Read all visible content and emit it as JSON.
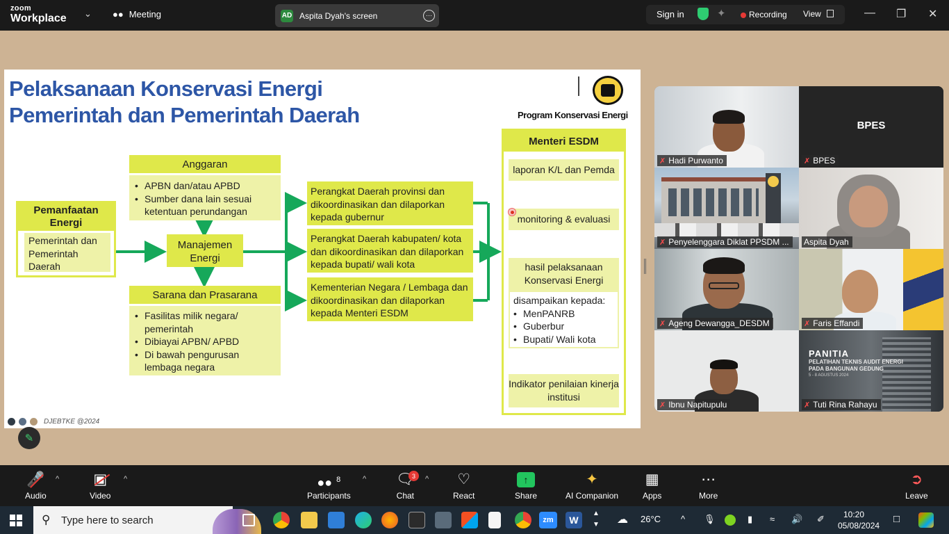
{
  "app": {
    "logo_line1": "zoom",
    "logo_line2": "Workplace",
    "meeting_label": "Meeting",
    "share_initials": "AD",
    "share_label": "Aspita Dyah's screen",
    "sign_in": "Sign in",
    "recording": "Recording",
    "view": "View"
  },
  "slide": {
    "title_line1": "Pelaksanaan Konservasi Energi",
    "title_line2": "Pemerintah dan Pemerintah Daerah",
    "program_tag": "Program Konservasi Energi",
    "pemanfaatan_title": "Pemanfaatan Energi",
    "pemanfaatan_body": "Pemerintah dan Pemerintah Daerah",
    "anggaran_title": "Anggaran",
    "anggaran_items": [
      "APBN dan/atau APBD",
      "Sumber dana lain sesuai ketentuan perundangan"
    ],
    "manajemen": "Manajemen Energi",
    "sarana_title": "Sarana dan Prasarana",
    "sarana_items": [
      "Fasilitas milik negara/ pemerintah",
      "Dibiayai APBN/ APBD",
      "Di bawah pengurusan lembaga negara"
    ],
    "perangkat_provinsi": "Perangkat Daerah provinsi dan dikoordinasikan dan dilaporkan kepada gubernur",
    "perangkat_kabupaten": "Perangkat Daerah kabupaten/ kota dan dikoordinasikan dan dilaporkan kepada bupati/ wali kota",
    "kementerian": "Kementerian Negara / Lembaga dan dikoordinasikan dan dilaporkan kepada Menteri ESDM",
    "menteri_title": "Menteri ESDM",
    "laporan": "laporan K/L dan Pemda",
    "monitoring": "monitoring & evaluasi",
    "hasil": "hasil pelaksanaan Konservasi Energi",
    "disampaikan_label": "disampaikan kepada:",
    "disampaikan_items": [
      "MenPANRB",
      "Guberbur",
      "Bupati/ Wali kota"
    ],
    "indikator": "Indikator penilaian kinerja institusi",
    "footer": "DJEBTKE @2024"
  },
  "participants_tiles": [
    {
      "name": "Hadi Purwanto"
    },
    {
      "name": "BPES",
      "big_label": "BPES"
    },
    {
      "name": "Penyelenggara Diklat PPSDM ..."
    },
    {
      "name": "Aspita Dyah"
    },
    {
      "name": "Ageng Dewangga_DESDM"
    },
    {
      "name": "Faris Effandi"
    },
    {
      "name": "Ibnu Napitupulu"
    },
    {
      "name": "Tuti Rina Rahayu",
      "banner_title": "PANITIA",
      "banner_sub1": "PELATIHAN TEKNIS AUDIT ENERGI",
      "banner_sub2": "PADA BANGUNAN GEDUNG",
      "banner_date": "5 - 8 AGUSTUS 2024"
    }
  ],
  "toolbar": {
    "audio": "Audio",
    "video": "Video",
    "participants": "Participants",
    "participants_count": "8",
    "chat": "Chat",
    "chat_badge": "3",
    "react": "React",
    "share": "Share",
    "ai": "AI Companion",
    "apps": "Apps",
    "more": "More",
    "leave": "Leave"
  },
  "taskbar": {
    "search_placeholder": "Type here to search",
    "weather": "26°C",
    "time": "10:20",
    "date": "05/08/2024"
  },
  "colors": {
    "slide_blue": "#2d56a6",
    "box_yellow": "#dfe84a",
    "arrow_green": "#16a85a",
    "accent_green": "#22c55e",
    "recording_red": "#e53935"
  }
}
